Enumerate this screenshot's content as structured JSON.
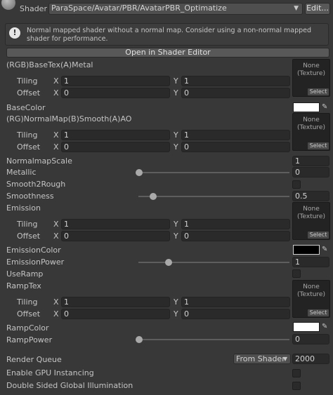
{
  "header": {
    "shader_label": "Shader",
    "shader_value": "ParaSpace/Avatar/PBR/AvatarPBR_Optimatize",
    "edit_button": "Edit...",
    "help_text": "Normal mapped shader without a normal map. Consider using a non-normal mapped shader for performance.",
    "open_editor": "Open in Shader Editor"
  },
  "texture_slot": {
    "none_line1": "None",
    "none_line2": "(Texture)",
    "select": "Select"
  },
  "tiling_label": "Tiling",
  "offset_label": "Offset",
  "axis_x": "X",
  "axis_y": "Y",
  "textures": [
    {
      "name": "(RGB)BaseTex(A)Metal",
      "tiling_x": "1",
      "tiling_y": "1",
      "offset_x": "0",
      "offset_y": "0"
    },
    {
      "name": "(RG)NormalMap(B)Smooth(A)AO",
      "tiling_x": "1",
      "tiling_y": "1",
      "offset_x": "0",
      "offset_y": "0"
    },
    {
      "name": "Emission",
      "tiling_x": "1",
      "tiling_y": "1",
      "offset_x": "0",
      "offset_y": "0"
    },
    {
      "name": "RampTex",
      "tiling_x": "1",
      "tiling_y": "1",
      "offset_x": "0",
      "offset_y": "0"
    }
  ],
  "props": {
    "base_color": {
      "label": "BaseColor",
      "color": "#ffffff"
    },
    "normal_scale": {
      "label": "NormalmapScale",
      "value": "1"
    },
    "metallic": {
      "label": "Metallic",
      "value": "0",
      "fraction": 0.0
    },
    "smooth2rough": {
      "label": "Smooth2Rough",
      "checked": false
    },
    "smoothness": {
      "label": "Smoothness",
      "value": "0.5",
      "fraction": 0.12
    },
    "emission_color": {
      "label": "EmissionColor",
      "color": "#000000"
    },
    "emission_power": {
      "label": "EmissionPower",
      "value": "1",
      "fraction": 0.2
    },
    "use_ramp": {
      "label": "UseRamp",
      "checked": false
    },
    "ramp_color": {
      "label": "RampColor",
      "color": "#ffffff"
    },
    "ramp_power": {
      "label": "RampPower",
      "value": "0",
      "fraction": 0.0
    }
  },
  "footer": {
    "render_queue_label": "Render Queue",
    "render_queue_option": "From Shader",
    "render_queue_value": "2000",
    "gpu_instancing_label": "Enable GPU Instancing",
    "double_sided_label": "Double Sided Global Illumination"
  },
  "colors": {
    "background": "#383838",
    "field": "#2a2a2a",
    "text": "#c4c4c4"
  },
  "icons": [
    "avatar-preview-icon",
    "info-icon",
    "dropdown-arrow-icon",
    "eyedropper-icon"
  ]
}
